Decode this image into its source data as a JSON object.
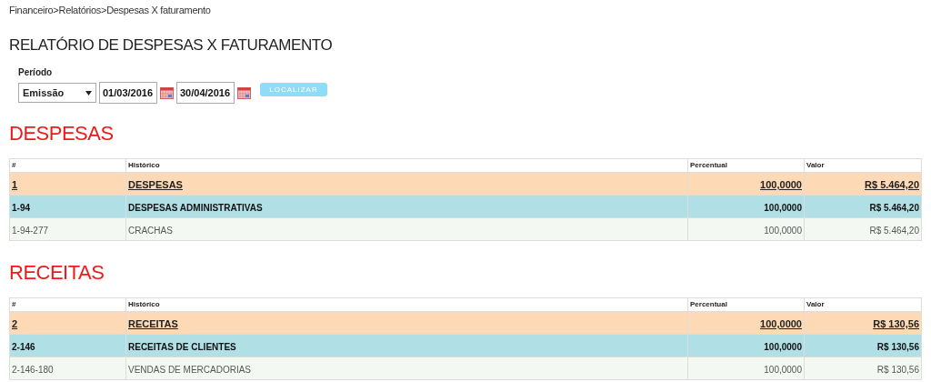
{
  "breadcrumb": "Financeiro>Relatórios>Despesas X faturamento",
  "title": "RELATÓRIO DE DESPESAS X FATURAMENTO",
  "filter": {
    "label": "Período",
    "type_select": "Emissão",
    "date_from": "01/03/2016",
    "date_to": "30/04/2016",
    "button": "LOCALIZAR"
  },
  "sections": [
    {
      "heading": "DESPESAS",
      "columns": [
        "#",
        "Histórico",
        "Percentual",
        "Valor"
      ],
      "rows": [
        {
          "kind": "group",
          "code": "1",
          "history": "DESPESAS",
          "percent": "100,0000",
          "value": "R$ 5.464,20"
        },
        {
          "kind": "subgroup",
          "code": "1-94",
          "history": "DESPESAS ADMINISTRATIVAS",
          "percent": "100,0000",
          "value": "R$ 5.464,20"
        },
        {
          "kind": "item",
          "code": "1-94-277",
          "history": "CRACHAS",
          "percent": "100,0000",
          "value": "R$ 5.464,20"
        }
      ]
    },
    {
      "heading": "RECEITAS",
      "columns": [
        "#",
        "Histórico",
        "Percentual",
        "Valor"
      ],
      "rows": [
        {
          "kind": "group",
          "code": "2",
          "history": "RECEITAS",
          "percent": "100,0000",
          "value": "R$ 130,56"
        },
        {
          "kind": "subgroup",
          "code": "2-146",
          "history": "RECEITAS DE CLIENTES",
          "percent": "100,0000",
          "value": "R$ 130,56"
        },
        {
          "kind": "item",
          "code": "2-146-180",
          "history": "VENDAS DE MERCADORIAS",
          "percent": "100,0000",
          "value": "R$ 130,56"
        }
      ]
    }
  ]
}
